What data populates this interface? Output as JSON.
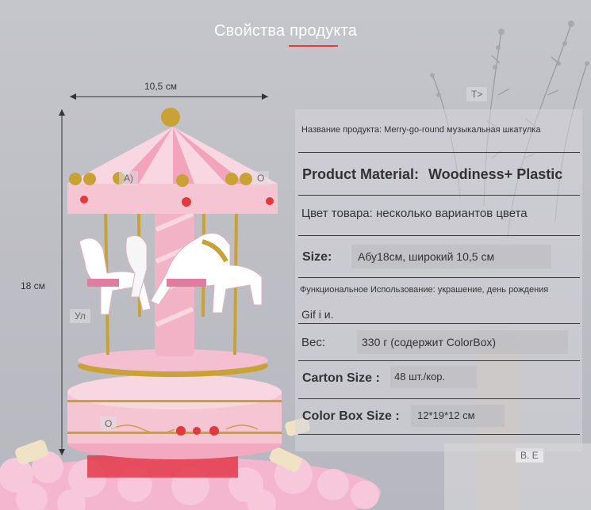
{
  "page_title": "Свойства продукта",
  "dimensions": {
    "width_label": "10,5 см",
    "height_label": "18 см"
  },
  "overlay_labels": {
    "a": "A)",
    "o1": "O",
    "o2": "O",
    "ul": "Ул",
    "t": "T>",
    "ve": "B. E"
  },
  "specs": {
    "name": "Название продукта: Merry-go-round музыкальная шкатулка",
    "material_label": "Product Material:",
    "material_value": "Woodiness+ Plastic",
    "color": "Цвет товара: несколько вариантов цвета",
    "size_label": "Size:",
    "size_value": "Абу18см, широкий 10,5 см",
    "function": "Функциональное Использование: украшение, день рождения",
    "gift": "Gif i и.",
    "weight_label": "Вес:",
    "weight_value": "330 г (содержит ColorBox)",
    "carton_label": "Carton Size :",
    "carton_value": "48 шт./кор.",
    "colorbox_label": "Color Box Size :",
    "colorbox_value": "12*19*12 см"
  },
  "colors": {
    "accent": "#e2402f",
    "pink": "#f4bfd0",
    "gold": "#c9a235"
  }
}
